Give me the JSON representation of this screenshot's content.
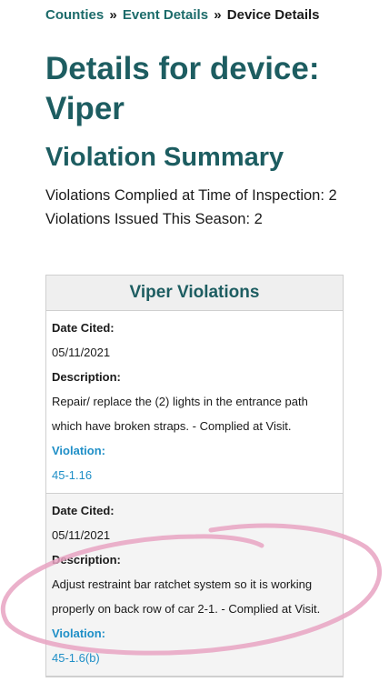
{
  "breadcrumb": {
    "items": [
      "Counties",
      "Event Details",
      "Device Details"
    ],
    "separator": "»"
  },
  "page_title": "Details for device: Viper",
  "section_title": "Violation Summary",
  "summary": {
    "line1": "Violations Complied at Time of Inspection: 2",
    "line2": "Violations Issued This Season: 2"
  },
  "table": {
    "title": "Viper Violations",
    "date_label": "Date Cited:",
    "description_label": "Description:",
    "violation_label": "Violation:",
    "rows": [
      {
        "date": "05/11/2021",
        "description": "Repair/ replace the (2) lights in the entrance path which have broken straps. - Complied at Visit.",
        "violation": "45-1.16"
      },
      {
        "date": "05/11/2021",
        "description": "Adjust restraint bar ratchet system so it is working properly on back row of car 2-1. - Complied at Visit.",
        "violation": "45-1.6(b)"
      }
    ]
  },
  "colors": {
    "heading": "#1d5d61",
    "link": "#1c6b6a",
    "violation": "#1f8fc7",
    "annotation": "#e7a3c2"
  }
}
